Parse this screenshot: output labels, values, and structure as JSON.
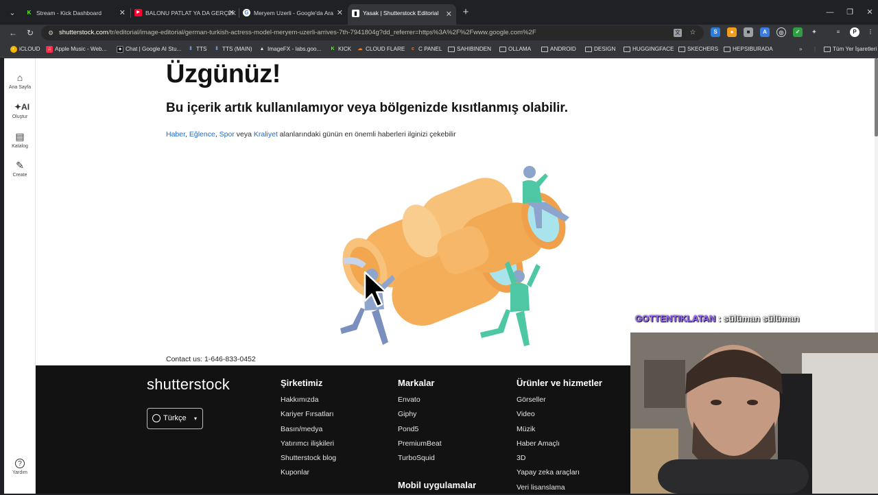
{
  "browser": {
    "tabs": [
      {
        "title": "Stream - Kick Dashboard",
        "icon": "kick-icon",
        "color": "#53fc18"
      },
      {
        "title": "BALONU PATLAT YA DA GERÇEK",
        "icon": "youtube-icon",
        "color": "#ff0033"
      },
      {
        "title": "Meryem Uzerli - Google'da Ara",
        "icon": "google-icon",
        "color": "#4285f4"
      },
      {
        "title": "Yasak | Shutterstock Editorial",
        "icon": "shutterstock-icon",
        "color": "#ffffff"
      }
    ],
    "active_tab": 3,
    "url_host": "shutterstock.com",
    "url_rest": "/tr/editorial/image-editorial/german-turkish-actress-model-meryem-uzerli-arrives-7th-7941804g?dd_referrer=https%3A%2F%2Fwww.google.com%2F",
    "bookmarks": [
      {
        "label": "iCLOUD",
        "icon": "icloud-icon"
      },
      {
        "label": "Apple Music - Web...",
        "icon": "apple-music-icon"
      },
      {
        "label": "Chat | Google AI Stu...",
        "icon": "google-ai-studio-icon"
      },
      {
        "label": "TTS",
        "icon": "tts-icon"
      },
      {
        "label": "TTS (MAIN)",
        "icon": "tts-icon"
      },
      {
        "label": "ImageFX - labs.goo...",
        "icon": "imagefx-icon"
      },
      {
        "label": "KICK",
        "icon": "kick-icon"
      },
      {
        "label": "CLOUD FLARE",
        "icon": "cloudflare-icon"
      },
      {
        "label": "C PANEL",
        "icon": "cpanel-icon"
      },
      {
        "label": "SAHIBINDEN",
        "icon": "folder-icon"
      },
      {
        "label": "OLLAMA",
        "icon": "folder-icon"
      },
      {
        "label": "ANDROID",
        "icon": "folder-icon"
      },
      {
        "label": "DESIGN",
        "icon": "folder-icon"
      },
      {
        "label": "HUGGINGFACE",
        "icon": "folder-icon"
      },
      {
        "label": "SKECHERS",
        "icon": "folder-icon"
      },
      {
        "label": "HEPSIBURADA",
        "icon": "folder-icon"
      }
    ],
    "all_bookmarks": "Tüm Yer İşaretleri"
  },
  "sidenav": {
    "home": "Ana Sayfa",
    "create_ai": "Oluştur",
    "catalog": "Katalog",
    "create": "Create",
    "help": "Yardım"
  },
  "main": {
    "title": "Üzgünüz!",
    "subtitle": "Bu içerik artık kullanılamıyor veya bölgenizde kısıtlanmış olabilir.",
    "link_haber": "Haber",
    "link_eglence": "Eğlence",
    "link_spor": "Spor",
    "link_kraliyet": "Kraliyet",
    "sep1": ", ",
    "sep2": ", ",
    "veya": " veya ",
    "lead_tail": " alanlarındaki günün en önemli haberleri ilginizi çekebilir",
    "contact": "Contact us: 1-646-833-0452"
  },
  "footer": {
    "logo": "shutterstock",
    "language": "Türkçe",
    "col1": {
      "heading": "Şirketimiz",
      "links": [
        "Hakkımızda",
        "Kariyer Fırsatları",
        "Basın/medya",
        "Yatırımcı ilişkileri",
        "Shutterstock blog",
        "Kuponlar"
      ]
    },
    "col2": {
      "heading": "Markalar",
      "links": [
        "Envato",
        "Giphy",
        "Pond5",
        "PremiumBeat",
        "TurboSquid"
      ]
    },
    "col2b": {
      "heading": "Mobil uygulamalar"
    },
    "col3": {
      "heading": "Ürünler ve hizmetler",
      "links": [
        "Görseller",
        "Video",
        "Müzik",
        "Haber Amaçlı",
        "3D",
        "Yapay zeka araçları",
        "Veri lisanslama"
      ]
    }
  },
  "overlay": {
    "chat_user": "GOTTENTIKLATAN",
    "chat_sep": " : ",
    "chat_msg": "sülüman sülüman"
  }
}
